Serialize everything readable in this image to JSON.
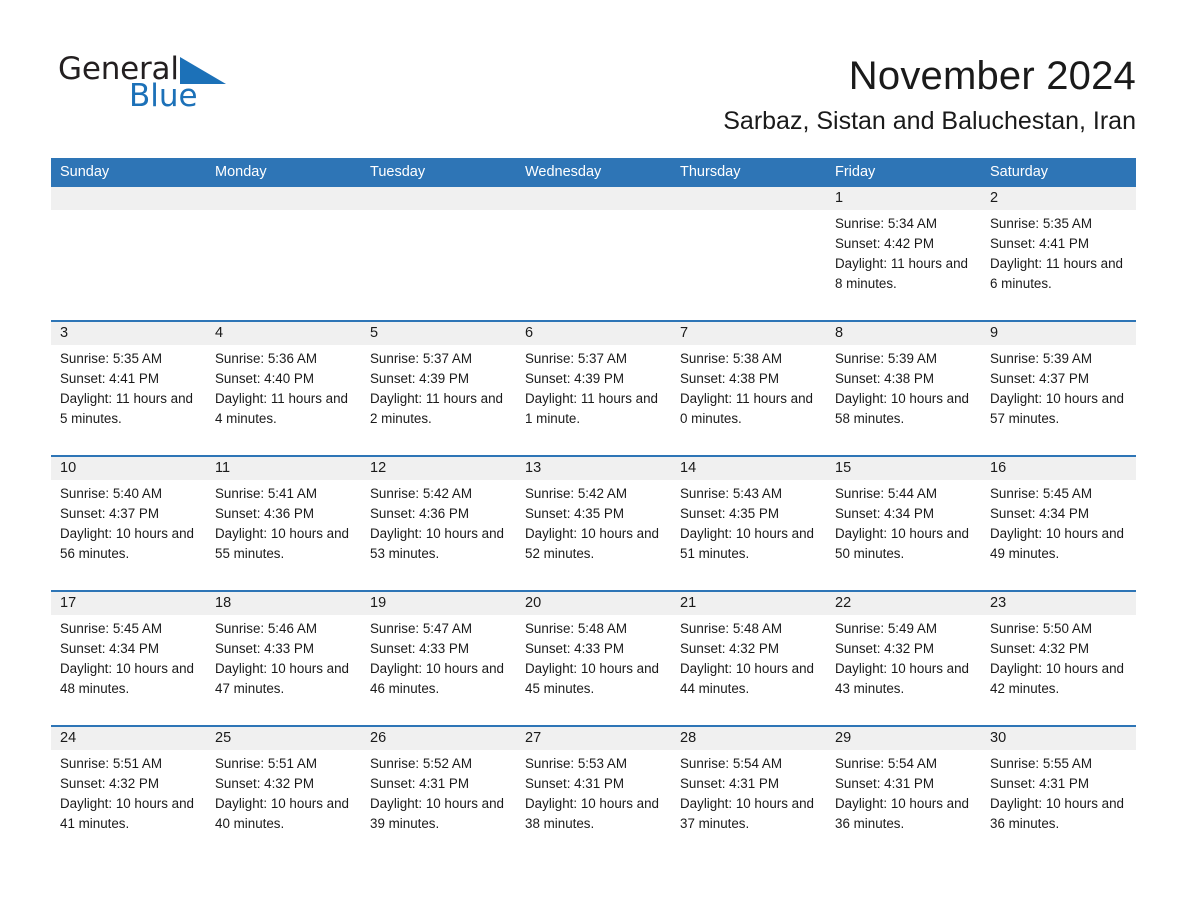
{
  "logo": {
    "word_dark": "General",
    "word_blue": "Blue",
    "triangle_color": "#1c71b8"
  },
  "header": {
    "title": "November 2024",
    "subtitle": "Sarbaz, Sistan and Baluchestan, Iran"
  },
  "colors": {
    "header_blue": "#2e75b6",
    "date_band_gray": "#f0f0f0",
    "text": "#1a1a1a"
  },
  "weekdays": [
    "Sunday",
    "Monday",
    "Tuesday",
    "Wednesday",
    "Thursday",
    "Friday",
    "Saturday"
  ],
  "weeks": [
    [
      {
        "day": "",
        "sunrise": "",
        "sunset": "",
        "daylight": ""
      },
      {
        "day": "",
        "sunrise": "",
        "sunset": "",
        "daylight": ""
      },
      {
        "day": "",
        "sunrise": "",
        "sunset": "",
        "daylight": ""
      },
      {
        "day": "",
        "sunrise": "",
        "sunset": "",
        "daylight": ""
      },
      {
        "day": "",
        "sunrise": "",
        "sunset": "",
        "daylight": ""
      },
      {
        "day": "1",
        "sunrise": "Sunrise: 5:34 AM",
        "sunset": "Sunset: 4:42 PM",
        "daylight": "Daylight: 11 hours and 8 minutes."
      },
      {
        "day": "2",
        "sunrise": "Sunrise: 5:35 AM",
        "sunset": "Sunset: 4:41 PM",
        "daylight": "Daylight: 11 hours and 6 minutes."
      }
    ],
    [
      {
        "day": "3",
        "sunrise": "Sunrise: 5:35 AM",
        "sunset": "Sunset: 4:41 PM",
        "daylight": "Daylight: 11 hours and 5 minutes."
      },
      {
        "day": "4",
        "sunrise": "Sunrise: 5:36 AM",
        "sunset": "Sunset: 4:40 PM",
        "daylight": "Daylight: 11 hours and 4 minutes."
      },
      {
        "day": "5",
        "sunrise": "Sunrise: 5:37 AM",
        "sunset": "Sunset: 4:39 PM",
        "daylight": "Daylight: 11 hours and 2 minutes."
      },
      {
        "day": "6",
        "sunrise": "Sunrise: 5:37 AM",
        "sunset": "Sunset: 4:39 PM",
        "daylight": "Daylight: 11 hours and 1 minute."
      },
      {
        "day": "7",
        "sunrise": "Sunrise: 5:38 AM",
        "sunset": "Sunset: 4:38 PM",
        "daylight": "Daylight: 11 hours and 0 minutes."
      },
      {
        "day": "8",
        "sunrise": "Sunrise: 5:39 AM",
        "sunset": "Sunset: 4:38 PM",
        "daylight": "Daylight: 10 hours and 58 minutes."
      },
      {
        "day": "9",
        "sunrise": "Sunrise: 5:39 AM",
        "sunset": "Sunset: 4:37 PM",
        "daylight": "Daylight: 10 hours and 57 minutes."
      }
    ],
    [
      {
        "day": "10",
        "sunrise": "Sunrise: 5:40 AM",
        "sunset": "Sunset: 4:37 PM",
        "daylight": "Daylight: 10 hours and 56 minutes."
      },
      {
        "day": "11",
        "sunrise": "Sunrise: 5:41 AM",
        "sunset": "Sunset: 4:36 PM",
        "daylight": "Daylight: 10 hours and 55 minutes."
      },
      {
        "day": "12",
        "sunrise": "Sunrise: 5:42 AM",
        "sunset": "Sunset: 4:36 PM",
        "daylight": "Daylight: 10 hours and 53 minutes."
      },
      {
        "day": "13",
        "sunrise": "Sunrise: 5:42 AM",
        "sunset": "Sunset: 4:35 PM",
        "daylight": "Daylight: 10 hours and 52 minutes."
      },
      {
        "day": "14",
        "sunrise": "Sunrise: 5:43 AM",
        "sunset": "Sunset: 4:35 PM",
        "daylight": "Daylight: 10 hours and 51 minutes."
      },
      {
        "day": "15",
        "sunrise": "Sunrise: 5:44 AM",
        "sunset": "Sunset: 4:34 PM",
        "daylight": "Daylight: 10 hours and 50 minutes."
      },
      {
        "day": "16",
        "sunrise": "Sunrise: 5:45 AM",
        "sunset": "Sunset: 4:34 PM",
        "daylight": "Daylight: 10 hours and 49 minutes."
      }
    ],
    [
      {
        "day": "17",
        "sunrise": "Sunrise: 5:45 AM",
        "sunset": "Sunset: 4:34 PM",
        "daylight": "Daylight: 10 hours and 48 minutes."
      },
      {
        "day": "18",
        "sunrise": "Sunrise: 5:46 AM",
        "sunset": "Sunset: 4:33 PM",
        "daylight": "Daylight: 10 hours and 47 minutes."
      },
      {
        "day": "19",
        "sunrise": "Sunrise: 5:47 AM",
        "sunset": "Sunset: 4:33 PM",
        "daylight": "Daylight: 10 hours and 46 minutes."
      },
      {
        "day": "20",
        "sunrise": "Sunrise: 5:48 AM",
        "sunset": "Sunset: 4:33 PM",
        "daylight": "Daylight: 10 hours and 45 minutes."
      },
      {
        "day": "21",
        "sunrise": "Sunrise: 5:48 AM",
        "sunset": "Sunset: 4:32 PM",
        "daylight": "Daylight: 10 hours and 44 minutes."
      },
      {
        "day": "22",
        "sunrise": "Sunrise: 5:49 AM",
        "sunset": "Sunset: 4:32 PM",
        "daylight": "Daylight: 10 hours and 43 minutes."
      },
      {
        "day": "23",
        "sunrise": "Sunrise: 5:50 AM",
        "sunset": "Sunset: 4:32 PM",
        "daylight": "Daylight: 10 hours and 42 minutes."
      }
    ],
    [
      {
        "day": "24",
        "sunrise": "Sunrise: 5:51 AM",
        "sunset": "Sunset: 4:32 PM",
        "daylight": "Daylight: 10 hours and 41 minutes."
      },
      {
        "day": "25",
        "sunrise": "Sunrise: 5:51 AM",
        "sunset": "Sunset: 4:32 PM",
        "daylight": "Daylight: 10 hours and 40 minutes."
      },
      {
        "day": "26",
        "sunrise": "Sunrise: 5:52 AM",
        "sunset": "Sunset: 4:31 PM",
        "daylight": "Daylight: 10 hours and 39 minutes."
      },
      {
        "day": "27",
        "sunrise": "Sunrise: 5:53 AM",
        "sunset": "Sunset: 4:31 PM",
        "daylight": "Daylight: 10 hours and 38 minutes."
      },
      {
        "day": "28",
        "sunrise": "Sunrise: 5:54 AM",
        "sunset": "Sunset: 4:31 PM",
        "daylight": "Daylight: 10 hours and 37 minutes."
      },
      {
        "day": "29",
        "sunrise": "Sunrise: 5:54 AM",
        "sunset": "Sunset: 4:31 PM",
        "daylight": "Daylight: 10 hours and 36 minutes."
      },
      {
        "day": "30",
        "sunrise": "Sunrise: 5:55 AM",
        "sunset": "Sunset: 4:31 PM",
        "daylight": "Daylight: 10 hours and 36 minutes."
      }
    ]
  ]
}
